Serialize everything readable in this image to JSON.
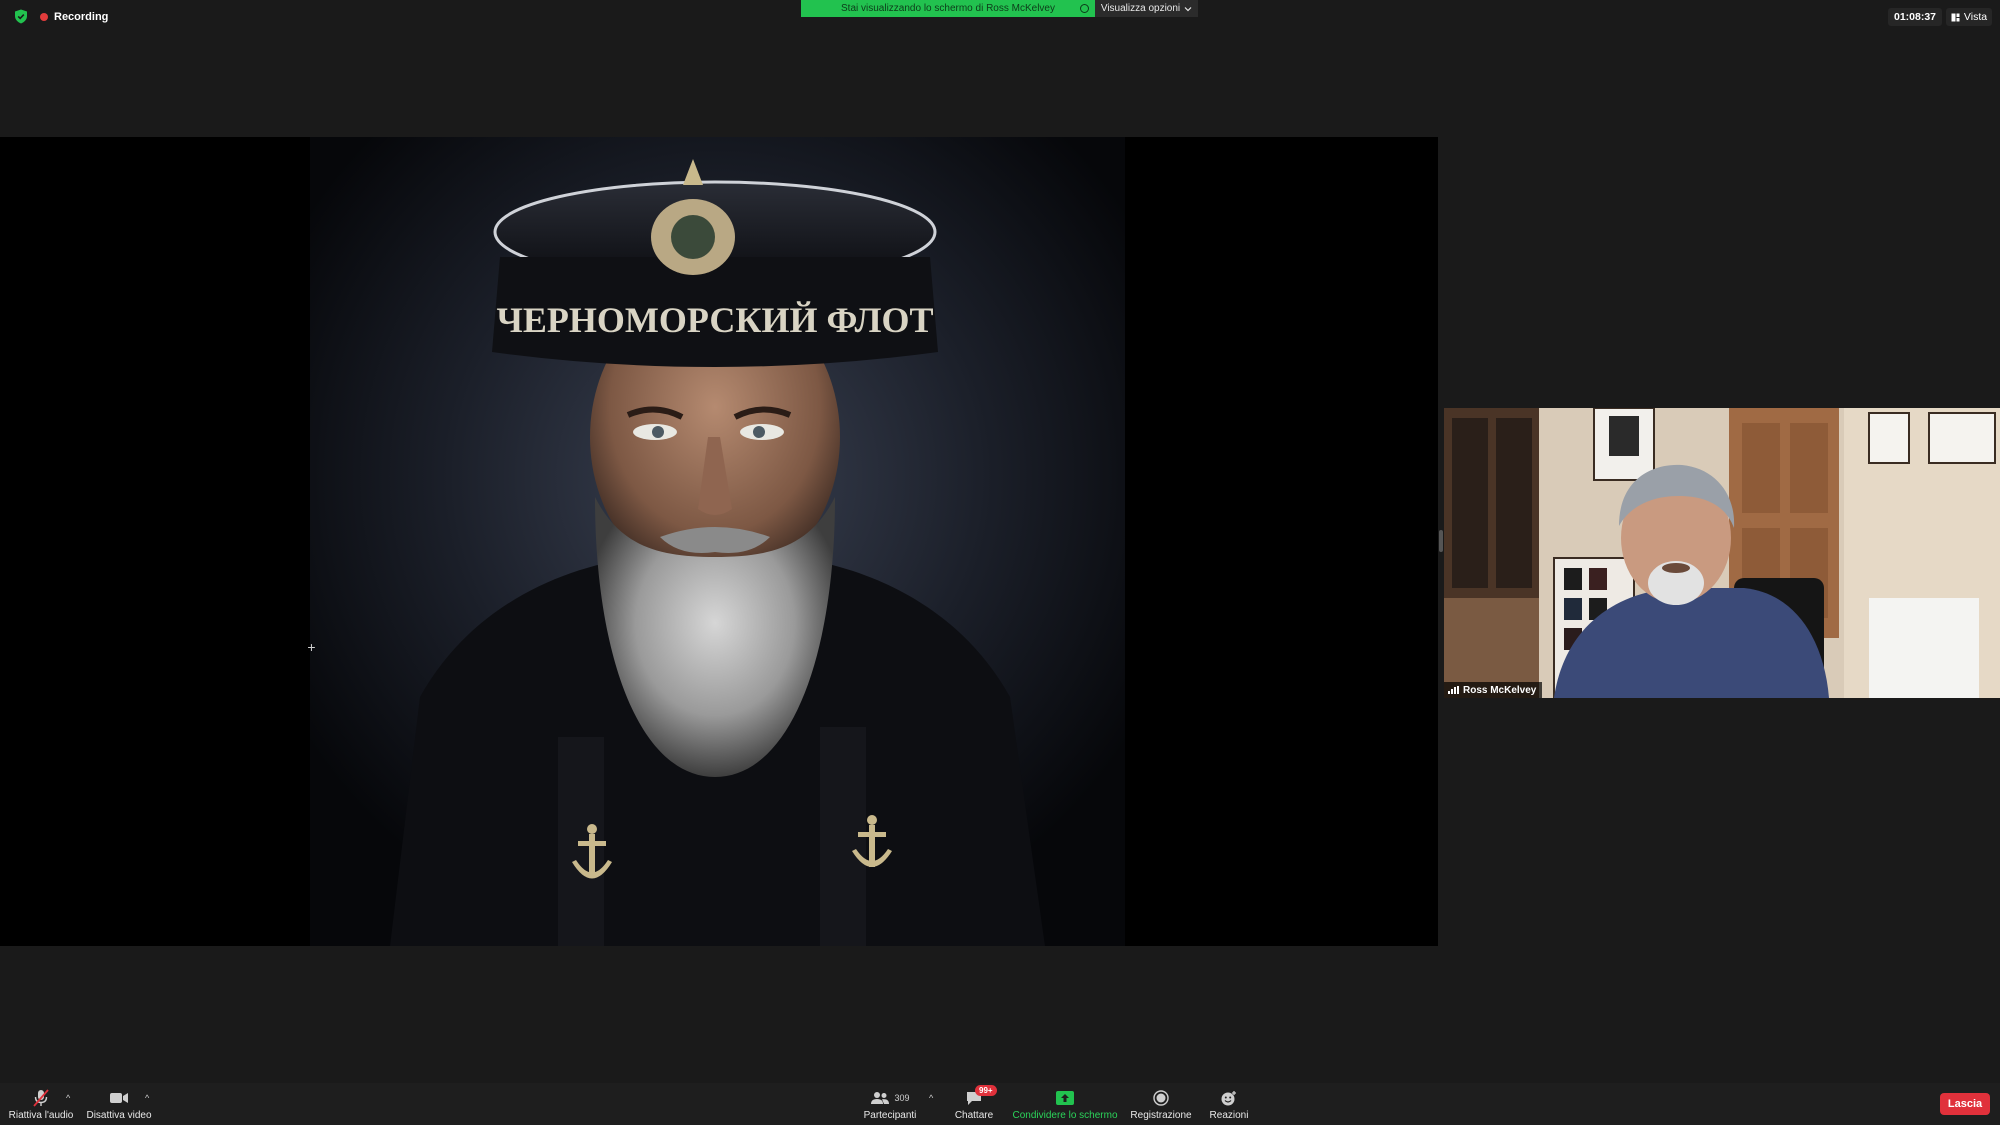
{
  "topbar": {
    "recording_label": "Recording",
    "share_banner_text": "Stai visualizzando lo schermo di Ross McKelvey",
    "view_options_label": "Visualizza opzioni",
    "timer": "01:08:37",
    "view_label": "Vista"
  },
  "shared_screen": {
    "cap_band_text": "ЧЕРНОМОРСКИЙ ФЛОТ"
  },
  "participant": {
    "name": "Ross McKelvey"
  },
  "toolbar": {
    "unmute_label": "Riattiva l'audio",
    "stop_video_label": "Disattiva video",
    "participants_label": "Partecipanti",
    "participants_count": "309",
    "chat_label": "Chattare",
    "chat_badge": "99+",
    "share_label": "Condividere lo schermo",
    "record_label": "Registrazione",
    "reactions_label": "Reazioni",
    "leave_label": "Lascia"
  },
  "colors": {
    "background": "#1a1a1a",
    "share_green": "#22c24f",
    "recording_red": "#e23c3c",
    "leave_red": "#e0313b"
  }
}
